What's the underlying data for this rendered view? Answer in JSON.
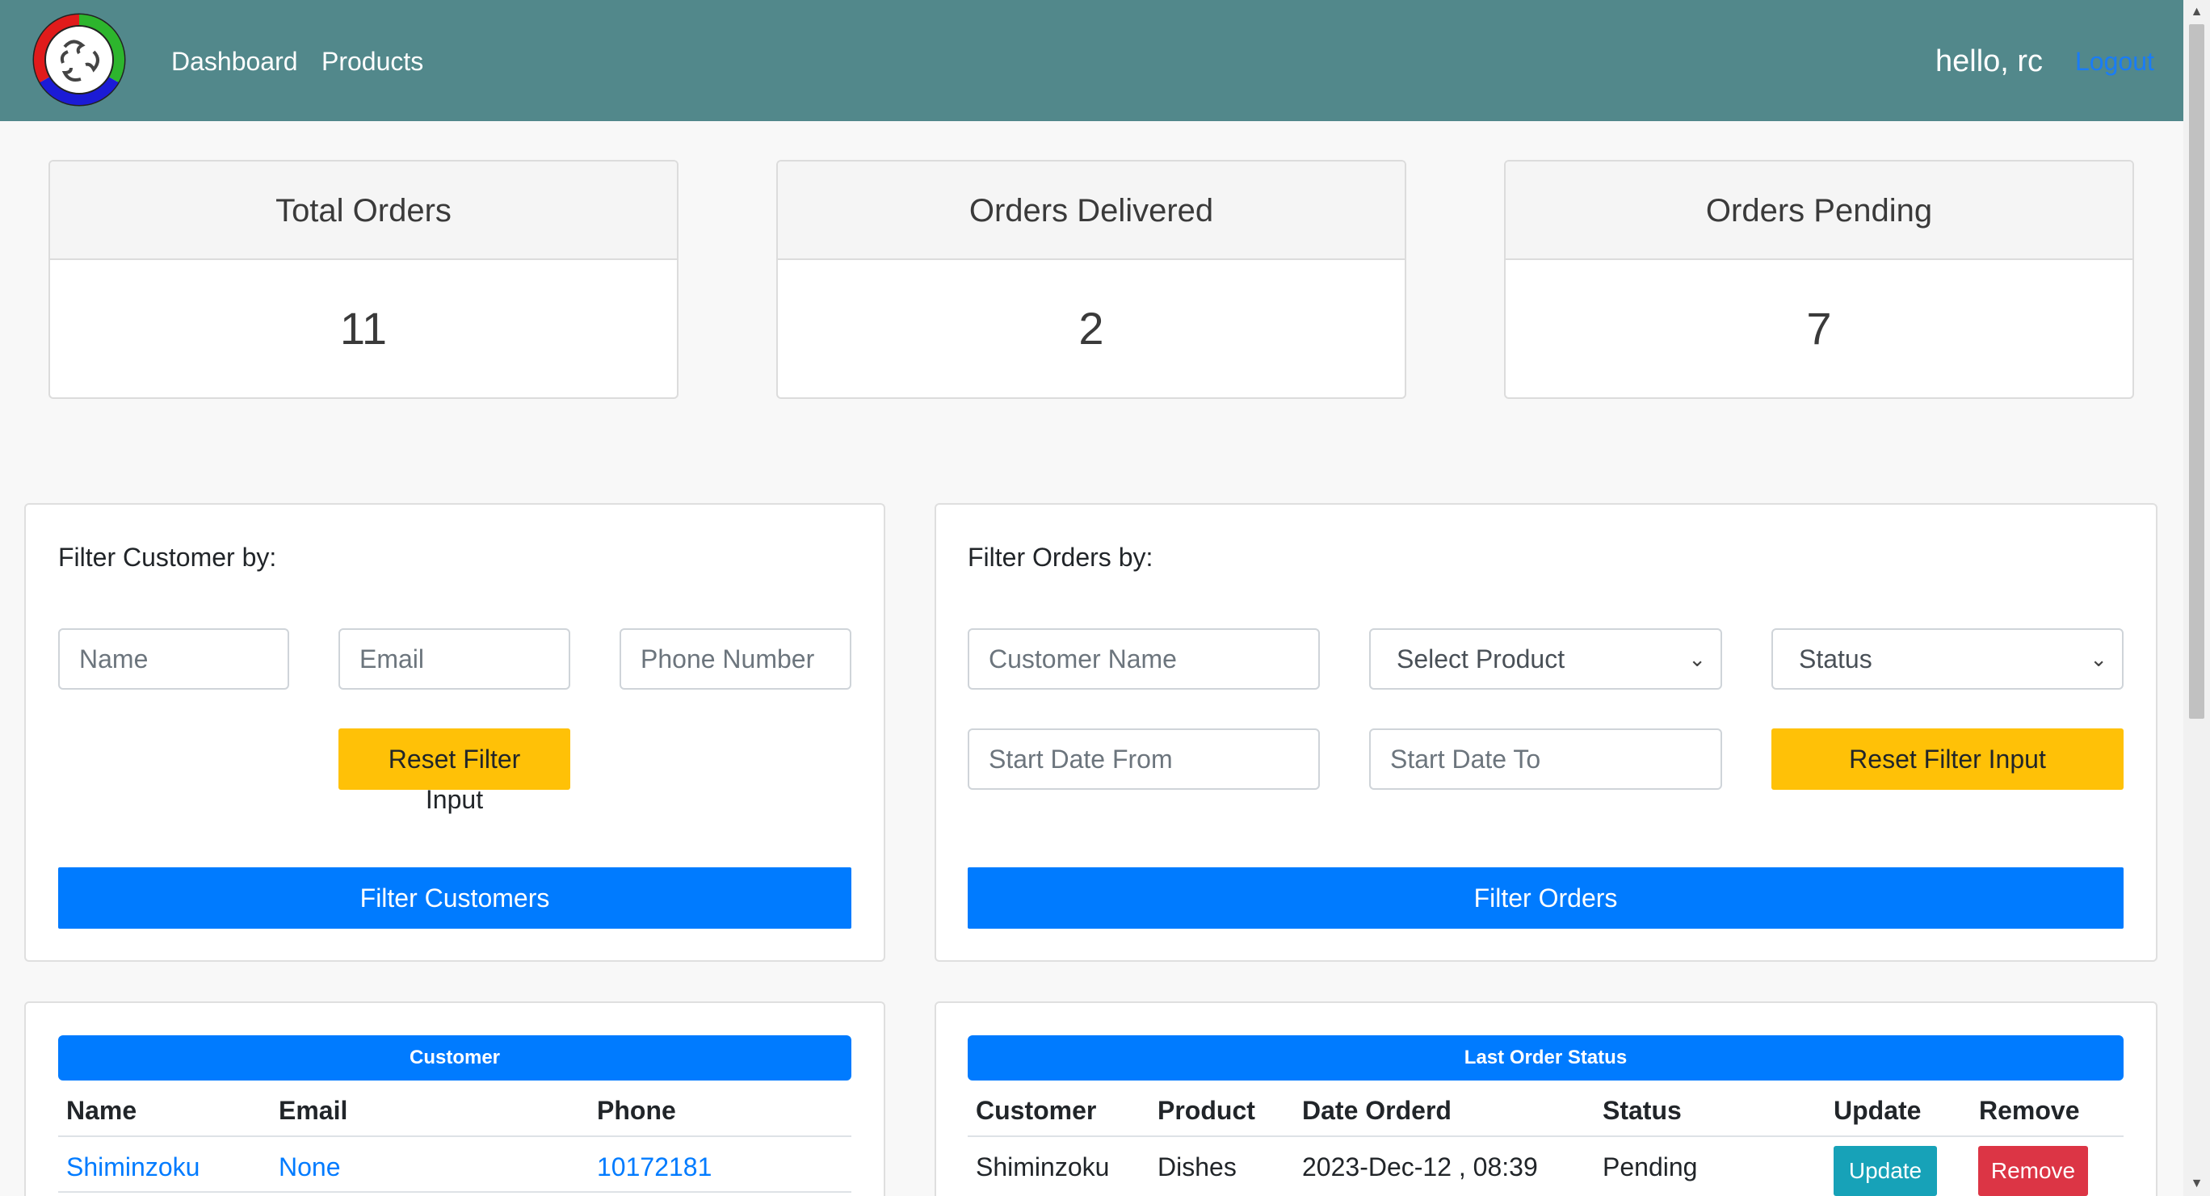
{
  "nav": {
    "links": [
      "Dashboard",
      "Products"
    ],
    "greeting": "hello, rc",
    "logout": "Logout",
    "logo_icon": "four-arrows-circle-logo"
  },
  "stats": [
    {
      "title": "Total Orders",
      "value": "11"
    },
    {
      "title": "Orders Delivered",
      "value": "2"
    },
    {
      "title": "Orders Pending",
      "value": "7"
    }
  ],
  "customer_filter": {
    "label": "Filter Customer by:",
    "name_placeholder": "Name",
    "email_placeholder": "Email",
    "phone_placeholder": "Phone Number",
    "reset_label": "Reset Filter",
    "reset_label_wrap": "Input",
    "submit_label": "Filter Customers"
  },
  "order_filter": {
    "label": "Filter Orders by:",
    "customer_placeholder": "Customer Name",
    "product_select": "Select Product",
    "status_select": "Status",
    "start_from_placeholder": "Start Date From",
    "start_to_placeholder": "Start Date To",
    "reset_label": "Reset Filter Input",
    "submit_label": "Filter Orders"
  },
  "customer_table": {
    "title": "Customer",
    "headers": [
      "Name",
      "Email",
      "Phone"
    ],
    "rows": [
      [
        "Shiminzoku",
        "None",
        "10172181"
      ]
    ]
  },
  "order_table": {
    "title": "Last Order Status",
    "headers": [
      "Customer",
      "Product",
      "Date Orderd",
      "Status",
      "Update",
      "Remove"
    ],
    "rows": [
      {
        "customer": "Shiminzoku",
        "product": "Dishes",
        "date": "2023-Dec-12 , 08:39",
        "status": "Pending",
        "update": "Update",
        "remove": "Remove"
      }
    ]
  },
  "colors": {
    "navbar": "#52888b",
    "primary": "#007bff",
    "warning": "#ffc107",
    "info": "#17a2b8",
    "danger": "#dc3545"
  }
}
